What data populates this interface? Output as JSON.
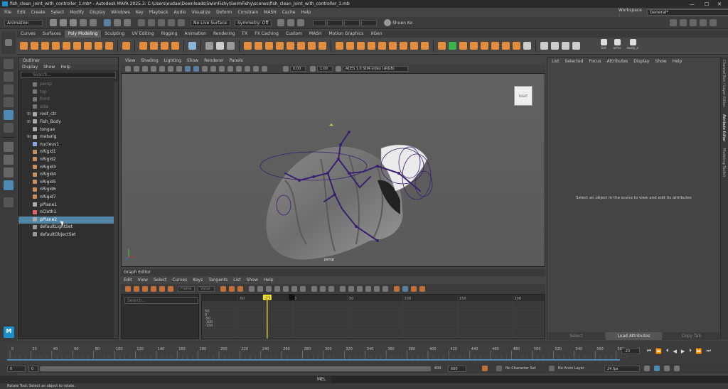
{
  "app": {
    "title": "fish_clean_joint_with_controller_1.mb* - Autodesk MAYA 2025.3: C:\\Users\\eudae\\Downloads\\SwimFishy\\SwimFishy\\scenes\\fish_clean_joint_with_controller_1.mb",
    "workspace_label": "Workspace :",
    "workspace_value": "General*",
    "user": "Shuen Ko"
  },
  "menubar": [
    "File",
    "Edit",
    "Create",
    "Select",
    "Modify",
    "Display",
    "Windows",
    "Key",
    "Playback",
    "Audio",
    "Visualize",
    "Deform",
    "Constrain",
    "MASH",
    "Cache",
    "Help"
  ],
  "statusline": {
    "menuset": "Animation",
    "live_surface": "No Live Surface",
    "symmetry": "Symmetry: Off"
  },
  "shelf_tabs": [
    "Curves",
    "Surfaces",
    "Poly Modeling",
    "Sculpting",
    "UV Editing",
    "Rigging",
    "Animation",
    "Rendering",
    "FX",
    "FX Caching",
    "Custom",
    "MASH",
    "Motion Graphics",
    "XGen"
  ],
  "shelf_active": "Poly Modeling",
  "shelf_labels": [
    "Set",
    "arms",
    "body_s"
  ],
  "outliner": {
    "title": "Outliner",
    "menu": [
      "Display",
      "Show",
      "Help"
    ],
    "search_placeholder": "Search...",
    "items": [
      {
        "label": "persp",
        "dim": true,
        "icon": "camera-icon"
      },
      {
        "label": "top",
        "dim": true,
        "icon": "camera-icon"
      },
      {
        "label": "front",
        "dim": true,
        "icon": "camera-icon"
      },
      {
        "label": "side",
        "dim": true,
        "icon": "camera-icon"
      },
      {
        "label": "root_ctr",
        "expand": true,
        "icon": "curve-icon"
      },
      {
        "label": "Fish_Body",
        "expand": true,
        "icon": "mesh-icon"
      },
      {
        "label": "tongue",
        "icon": "mesh-icon"
      },
      {
        "label": "metarig",
        "expand": true,
        "icon": "joint-icon"
      },
      {
        "label": "nucleus1",
        "icon": "nucleus-icon"
      },
      {
        "label": "nRigid1",
        "icon": "nrigid-icon"
      },
      {
        "label": "nRigid2",
        "icon": "nrigid-icon"
      },
      {
        "label": "nRigid3",
        "icon": "nrigid-icon"
      },
      {
        "label": "nRigid4",
        "icon": "nrigid-icon"
      },
      {
        "label": "nRigid5",
        "icon": "nrigid-icon"
      },
      {
        "label": "nRigid6",
        "icon": "nrigid-icon"
      },
      {
        "label": "nRigid7",
        "icon": "nrigid-icon"
      },
      {
        "label": "pPlane1",
        "icon": "mesh-icon"
      },
      {
        "label": "nCloth1",
        "icon": "ncloth-icon"
      },
      {
        "label": "pPlane2",
        "icon": "mesh-icon",
        "selected": true
      },
      {
        "label": "defaultLightSet",
        "icon": "set-icon"
      },
      {
        "label": "defaultObjectSet",
        "icon": "set-icon"
      }
    ]
  },
  "viewport": {
    "menu": [
      "View",
      "Shading",
      "Lighting",
      "Show",
      "Renderer",
      "Panels"
    ],
    "field1": "0.00",
    "field2": "1.00",
    "colorspace": "ACES 1.0 SDR-video (sRGB)",
    "camera_label": "persp",
    "viewcube_label": "RIGHT"
  },
  "graph_editor": {
    "title": "Graph Editor",
    "menu": [
      "Edit",
      "View",
      "Select",
      "Curves",
      "Keys",
      "Tangents",
      "List",
      "Show",
      "Help"
    ],
    "frame_label": "Frame",
    "value_label": "Value",
    "search_placeholder": "Search...",
    "ruler": [
      "-50",
      "0",
      "50",
      "100",
      "150",
      "200"
    ],
    "current_frame": "-23",
    "values": [
      "50",
      "0",
      "-50",
      "-100",
      "-150"
    ]
  },
  "attribute_editor": {
    "menu": [
      "List",
      "Selected",
      "Focus",
      "Attributes",
      "Display",
      "Show",
      "Help"
    ],
    "message": "Select an object in the scene to view and edit its attributes",
    "buttons": [
      "Select",
      "Load Attributes",
      "Copy Tab"
    ]
  },
  "side_tabs": [
    "Channel Box / Layer Editor",
    "Attribute Editor",
    "Modeling Toolkit"
  ],
  "timeline": {
    "ticks": [
      "0",
      "20",
      "40",
      "60",
      "80",
      "100",
      "120",
      "140",
      "160",
      "180",
      "200",
      "220",
      "240",
      "260",
      "280",
      "300",
      "320",
      "340",
      "360",
      "380",
      "400",
      "420",
      "440",
      "460",
      "480",
      "500",
      "520",
      "540",
      "560",
      "580"
    ],
    "current_frame": "-23"
  },
  "range": {
    "start": "0",
    "inner_start": "0",
    "inner_end": "600",
    "end": "600",
    "character_set": "No Character Set",
    "anim_layer": "No Anim Layer",
    "fps": "24 fps"
  },
  "cmdline": {
    "lang": "MEL"
  },
  "helpline": "Rotate Tool: Select an object to rotate.",
  "colors": {
    "selection": "#5285a6",
    "accent_orange": "#e38d3d",
    "rig_purple": "#3a1f6e",
    "playhead_yellow": "#f1e030"
  }
}
